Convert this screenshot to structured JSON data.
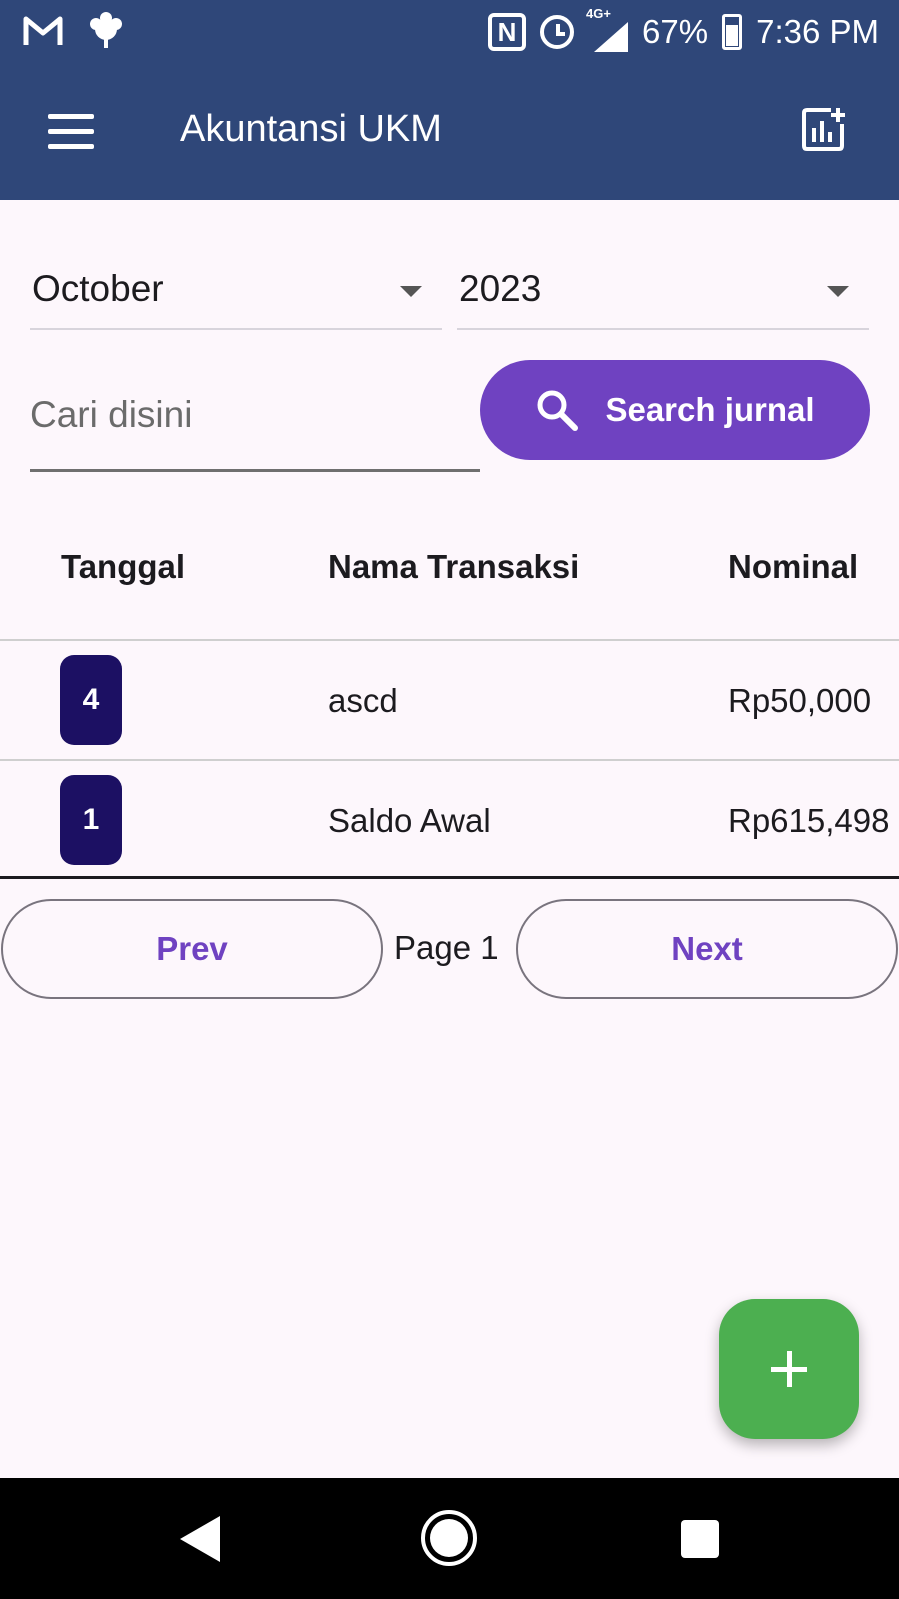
{
  "status_bar": {
    "battery": "67%",
    "time": "7:36 PM",
    "network": "4G+",
    "icons": [
      "gmail-icon",
      "leaf-icon",
      "nfc-icon",
      "alarm-icon",
      "signal-icon",
      "battery-icon"
    ]
  },
  "app_bar": {
    "title": "Akuntansi UKM",
    "icons": [
      "menu-icon",
      "chart-add-icon"
    ]
  },
  "filters": {
    "month": "October",
    "year": "2023"
  },
  "search": {
    "placeholder": "Cari disini",
    "value": "",
    "button_label": "Search jurnal"
  },
  "table": {
    "headers": {
      "date": "Tanggal",
      "name": "Nama Transaksi",
      "amount": "Nominal"
    },
    "rows": [
      {
        "day": "4",
        "name": "ascd",
        "amount": "Rp50,000"
      },
      {
        "day": "1",
        "name": "Saldo Awal",
        "amount": "Rp615,498"
      }
    ]
  },
  "pagination": {
    "prev_label": "Prev",
    "page_label": "Page 1",
    "next_label": "Next"
  },
  "fab": {
    "icon": "plus-icon"
  },
  "colors": {
    "app_bar": "#2f4779",
    "primary": "#6f42c1",
    "badge": "#1c1063",
    "fab": "#4caf50"
  }
}
